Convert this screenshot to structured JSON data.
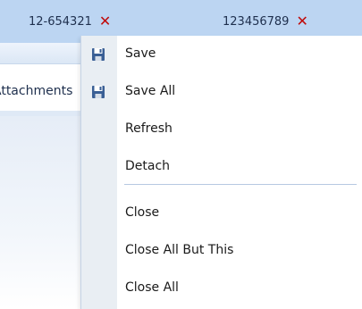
{
  "tabs": [
    {
      "label": "12-654321",
      "close_glyph": "✕"
    },
    {
      "label": "123456789",
      "close_glyph": "✕"
    }
  ],
  "subtab": {
    "label": "Attachments"
  },
  "context_menu": {
    "items": [
      {
        "label": "Save",
        "icon": "floppy-disk-icon"
      },
      {
        "label": "Save All",
        "icon": "floppy-disk-icon"
      },
      {
        "label": "Refresh"
      },
      {
        "label": "Detach"
      },
      {
        "label": "Close"
      },
      {
        "label": "Close All But This"
      },
      {
        "label": "Close All"
      }
    ]
  },
  "colors": {
    "tab_strip": "#bcd5f2",
    "close_x": "#c00a0a",
    "menu_gutter": "#e9eef3",
    "separator": "#b7c9e2"
  }
}
